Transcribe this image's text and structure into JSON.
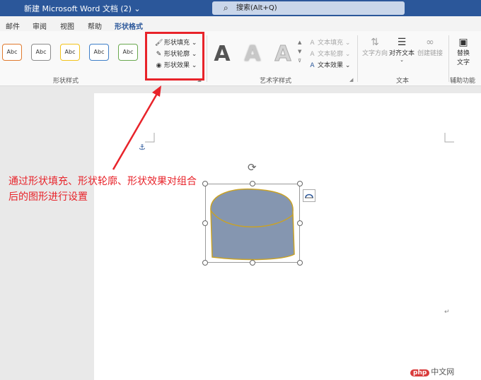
{
  "titlebar": {
    "title": "新建 Microsoft Word 文档 (2)  ⌄",
    "search_placeholder": "搜索(Alt+Q)"
  },
  "tabs": [
    {
      "label": "邮件"
    },
    {
      "label": "审阅"
    },
    {
      "label": "视图"
    },
    {
      "label": "帮助"
    },
    {
      "label": "形状格式",
      "active": true
    }
  ],
  "ribbon": {
    "shape_styles": {
      "label": "形状样式",
      "swatches": [
        {
          "text": "Abc",
          "color": "#e07a2e"
        },
        {
          "text": "Abc",
          "color": "#8c8c8c"
        },
        {
          "text": "Abc",
          "color": "#f2c31b"
        },
        {
          "text": "Abc",
          "color": "#3f7fc8"
        },
        {
          "text": "Abc",
          "color": "#6aa84f"
        }
      ],
      "fill": "形状填充 ⌄",
      "outline": "形状轮廓 ⌄",
      "effect": "形状效果 ⌄"
    },
    "wordart": {
      "label": "艺术字样式",
      "letter": "A",
      "text_fill": "文本填充 ⌄",
      "text_outline": "文本轮廓 ⌄",
      "text_effect": "文本效果 ⌄"
    },
    "text": {
      "label": "文本",
      "direction": "文字方向",
      "align": "对齐文本",
      "link": "创建链接"
    },
    "accessibility": {
      "label": "辅助功能",
      "alt_text_1": "替换",
      "alt_text_2": "文字"
    }
  },
  "annotation": {
    "text": "通过形状填充、形状轮廓、形状效果对组合后的图形进行设置",
    "color": "#e8232a"
  },
  "shape": {
    "fill_color": "#8596b0",
    "outline_color": "#c9a227"
  },
  "watermark": {
    "logo": "php",
    "site": "中文网"
  }
}
